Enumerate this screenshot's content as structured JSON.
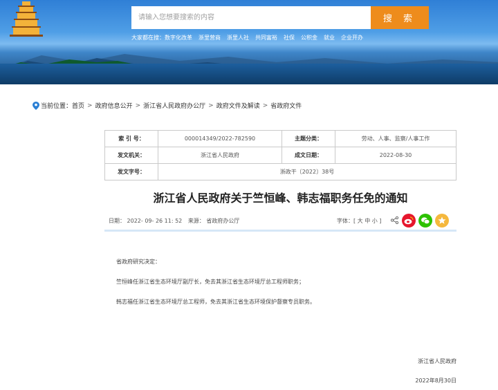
{
  "search": {
    "placeholder": "请输入您想要搜索的内容",
    "button_label": "搜 索"
  },
  "hot": {
    "label": "大家都在搜：",
    "items": [
      "数字化改革",
      "浙里营商",
      "浙里人社",
      "共同富裕",
      "社保",
      "公积金",
      "就业",
      "企业开办"
    ]
  },
  "breadcrumb": {
    "prefix": "当前位置：",
    "items": [
      "首页",
      "政府信息公开",
      "浙江省人民政府办公厅",
      "政府文件及解读",
      "省政府文件"
    ],
    "separator": ">"
  },
  "info": {
    "index_label": "索 引 号：",
    "index_value": "000014349/2022-782590",
    "category_label": "主题分类：",
    "category_value": "劳动、人事、监察/人事工作",
    "issuer_label": "发文机关：",
    "issuer_value": "浙江省人民政府",
    "date_label": "成文日期：",
    "date_value": "2022-08-30",
    "docno_label": "发文字号：",
    "docno_value": "浙政干〔2022〕38号"
  },
  "article": {
    "title": "浙江省人民政府关于竺恒峰、韩志福职务任免的通知",
    "meta_date": "日期：  2022- 09- 26 11: 52",
    "meta_source": "来源：  省政府办公厅",
    "font_size_label": "字体：[ 大  中  小 ]",
    "paragraphs": [
      "省政府研究决定：",
      "竺恒峰任浙江省生态环境厅副厅长，免去其浙江省生态环境厅总工程师职务；",
      "韩志福任浙江省生态环境厅总工程师，免去其浙江省生态环境保护督察专员职务。"
    ],
    "signature": "浙江省人民政府",
    "sign_date": "2022年8月30日"
  },
  "colors": {
    "search_button": "#ee8c1c",
    "weibo": "#e6162d",
    "wechat": "#2dc100",
    "favorite": "#f5b83d",
    "meta_border": "#d6e7f7"
  },
  "icons": [
    "location-pin-icon",
    "share-icon",
    "weibo-icon",
    "wechat-icon",
    "favorite-icon"
  ]
}
